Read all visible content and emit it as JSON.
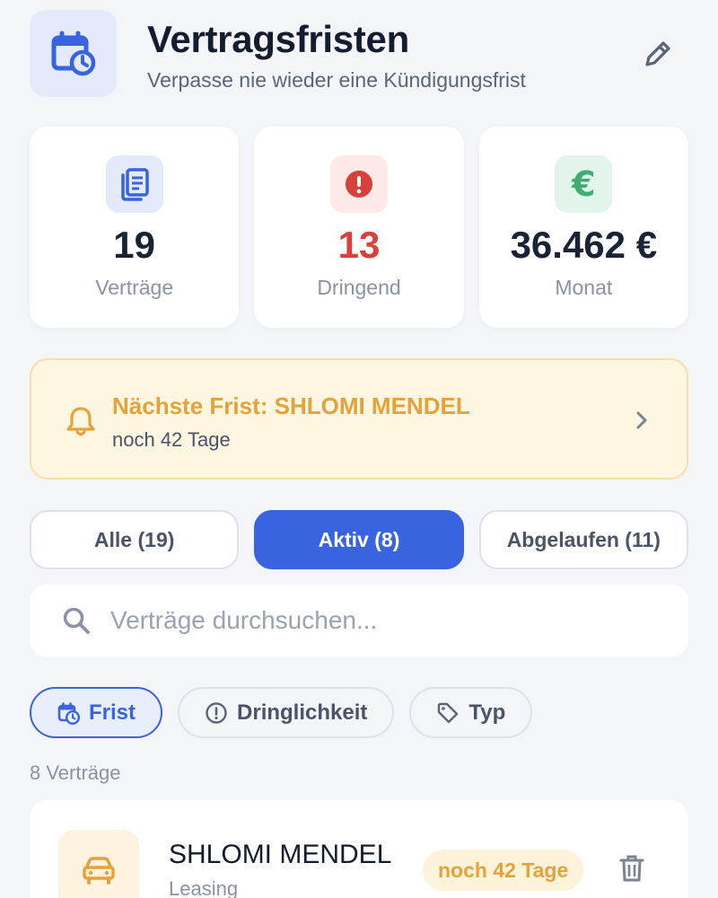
{
  "header": {
    "title": "Vertragsfristen",
    "subtitle": "Verpasse nie wieder eine Kündigungsfrist"
  },
  "stats": [
    {
      "value": "19",
      "label": "Verträge",
      "icon": "document-icon",
      "color": "#1a2236",
      "icon_color": "#3a63e0",
      "icon_bg": "#e4eafa"
    },
    {
      "value": "13",
      "label": "Dringend",
      "icon": "alert-icon",
      "color": "#d9403c",
      "icon_color": "#d9403c",
      "icon_bg": "#fce9e8"
    },
    {
      "value": "36.462 €",
      "label": "Monat",
      "icon": "euro-icon",
      "color": "#1a2236",
      "icon_color": "#3fae74",
      "icon_bg": "#e3f5ea"
    }
  ],
  "banner": {
    "title": "Nächste Frist: SHLOMI MENDEL",
    "subtitle": "noch 42 Tage",
    "accent": "#e6a23a"
  },
  "tabs": [
    {
      "label": "Alle (19)",
      "active": false
    },
    {
      "label": "Aktiv (8)",
      "active": true
    },
    {
      "label": "Abgelaufen (11)",
      "active": false
    }
  ],
  "search": {
    "placeholder": "Verträge durchsuchen...",
    "value": ""
  },
  "sort_chips": [
    {
      "label": "Frist",
      "icon": "calendar-clock-icon",
      "active": true
    },
    {
      "label": "Dringlichkeit",
      "icon": "alert-circle-icon",
      "active": false
    },
    {
      "label": "Typ",
      "icon": "tag-icon",
      "active": false
    }
  ],
  "list": {
    "count_label": "8 Verträge",
    "items": [
      {
        "name": "SHLOMI MENDEL",
        "type": "Leasing",
        "badge": "noch 42 Tage",
        "icon": "car-icon"
      }
    ]
  },
  "colors": {
    "primary": "#3a63e0",
    "warning": "#e6a23a",
    "danger": "#d9403c",
    "success": "#3fae74"
  }
}
